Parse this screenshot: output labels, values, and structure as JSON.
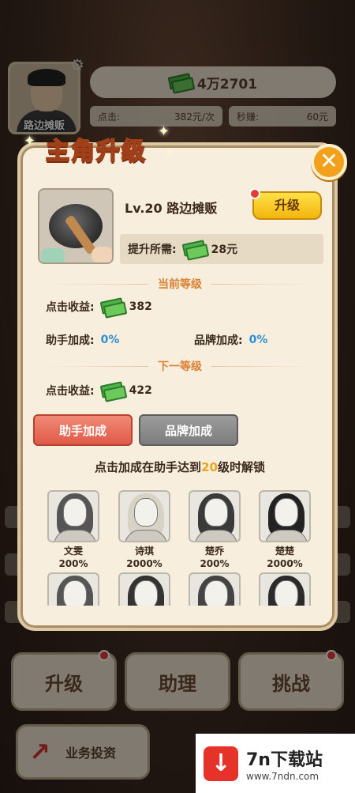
{
  "hud": {
    "avatar_label": "路边摊贩",
    "money": "4万2701",
    "click_label": "点击:",
    "click_value": "382元/次",
    "per_second_label": "秒赚:",
    "per_second_value": "60元"
  },
  "modal": {
    "title": "主角升级",
    "item_name": "Lv.20 路边摊贩",
    "upgrade_button": "升级",
    "cost_label": "提升所需:",
    "cost_value": "28元",
    "current_level_header": "当前等级",
    "current_click_label": "点击收益:",
    "current_click_value": "382",
    "assistant_bonus_label": "助手加成:",
    "assistant_bonus_value": "0%",
    "brand_bonus_label": "品牌加成:",
    "brand_bonus_value": "0%",
    "next_level_header": "下一等级",
    "next_click_label": "点击收益:",
    "next_click_value": "422",
    "tab_assistant": "助手加成",
    "tab_brand": "品牌加成",
    "unlock_prefix": "点击加成在助手达到",
    "unlock_level": "20",
    "unlock_suffix": "级时解锁",
    "assistants": [
      {
        "name": "文雯",
        "bonus": "200%"
      },
      {
        "name": "诗琪",
        "bonus": "2000%"
      },
      {
        "name": "楚乔",
        "bonus": "200%"
      },
      {
        "name": "楚楚",
        "bonus": "2000%"
      }
    ]
  },
  "bottom": {
    "upgrade": "升级",
    "assistant": "助理",
    "challenge": "挑战",
    "invest": "业务投资"
  },
  "watermark": {
    "title": "7n下载站",
    "url": "www.7ndn.com"
  },
  "colors": {
    "accent_orange": "#f3a11c",
    "active_tab": "#e05a48",
    "upgrade_yellow": "#ffe14a",
    "percent_blue": "#2d8fd1"
  }
}
